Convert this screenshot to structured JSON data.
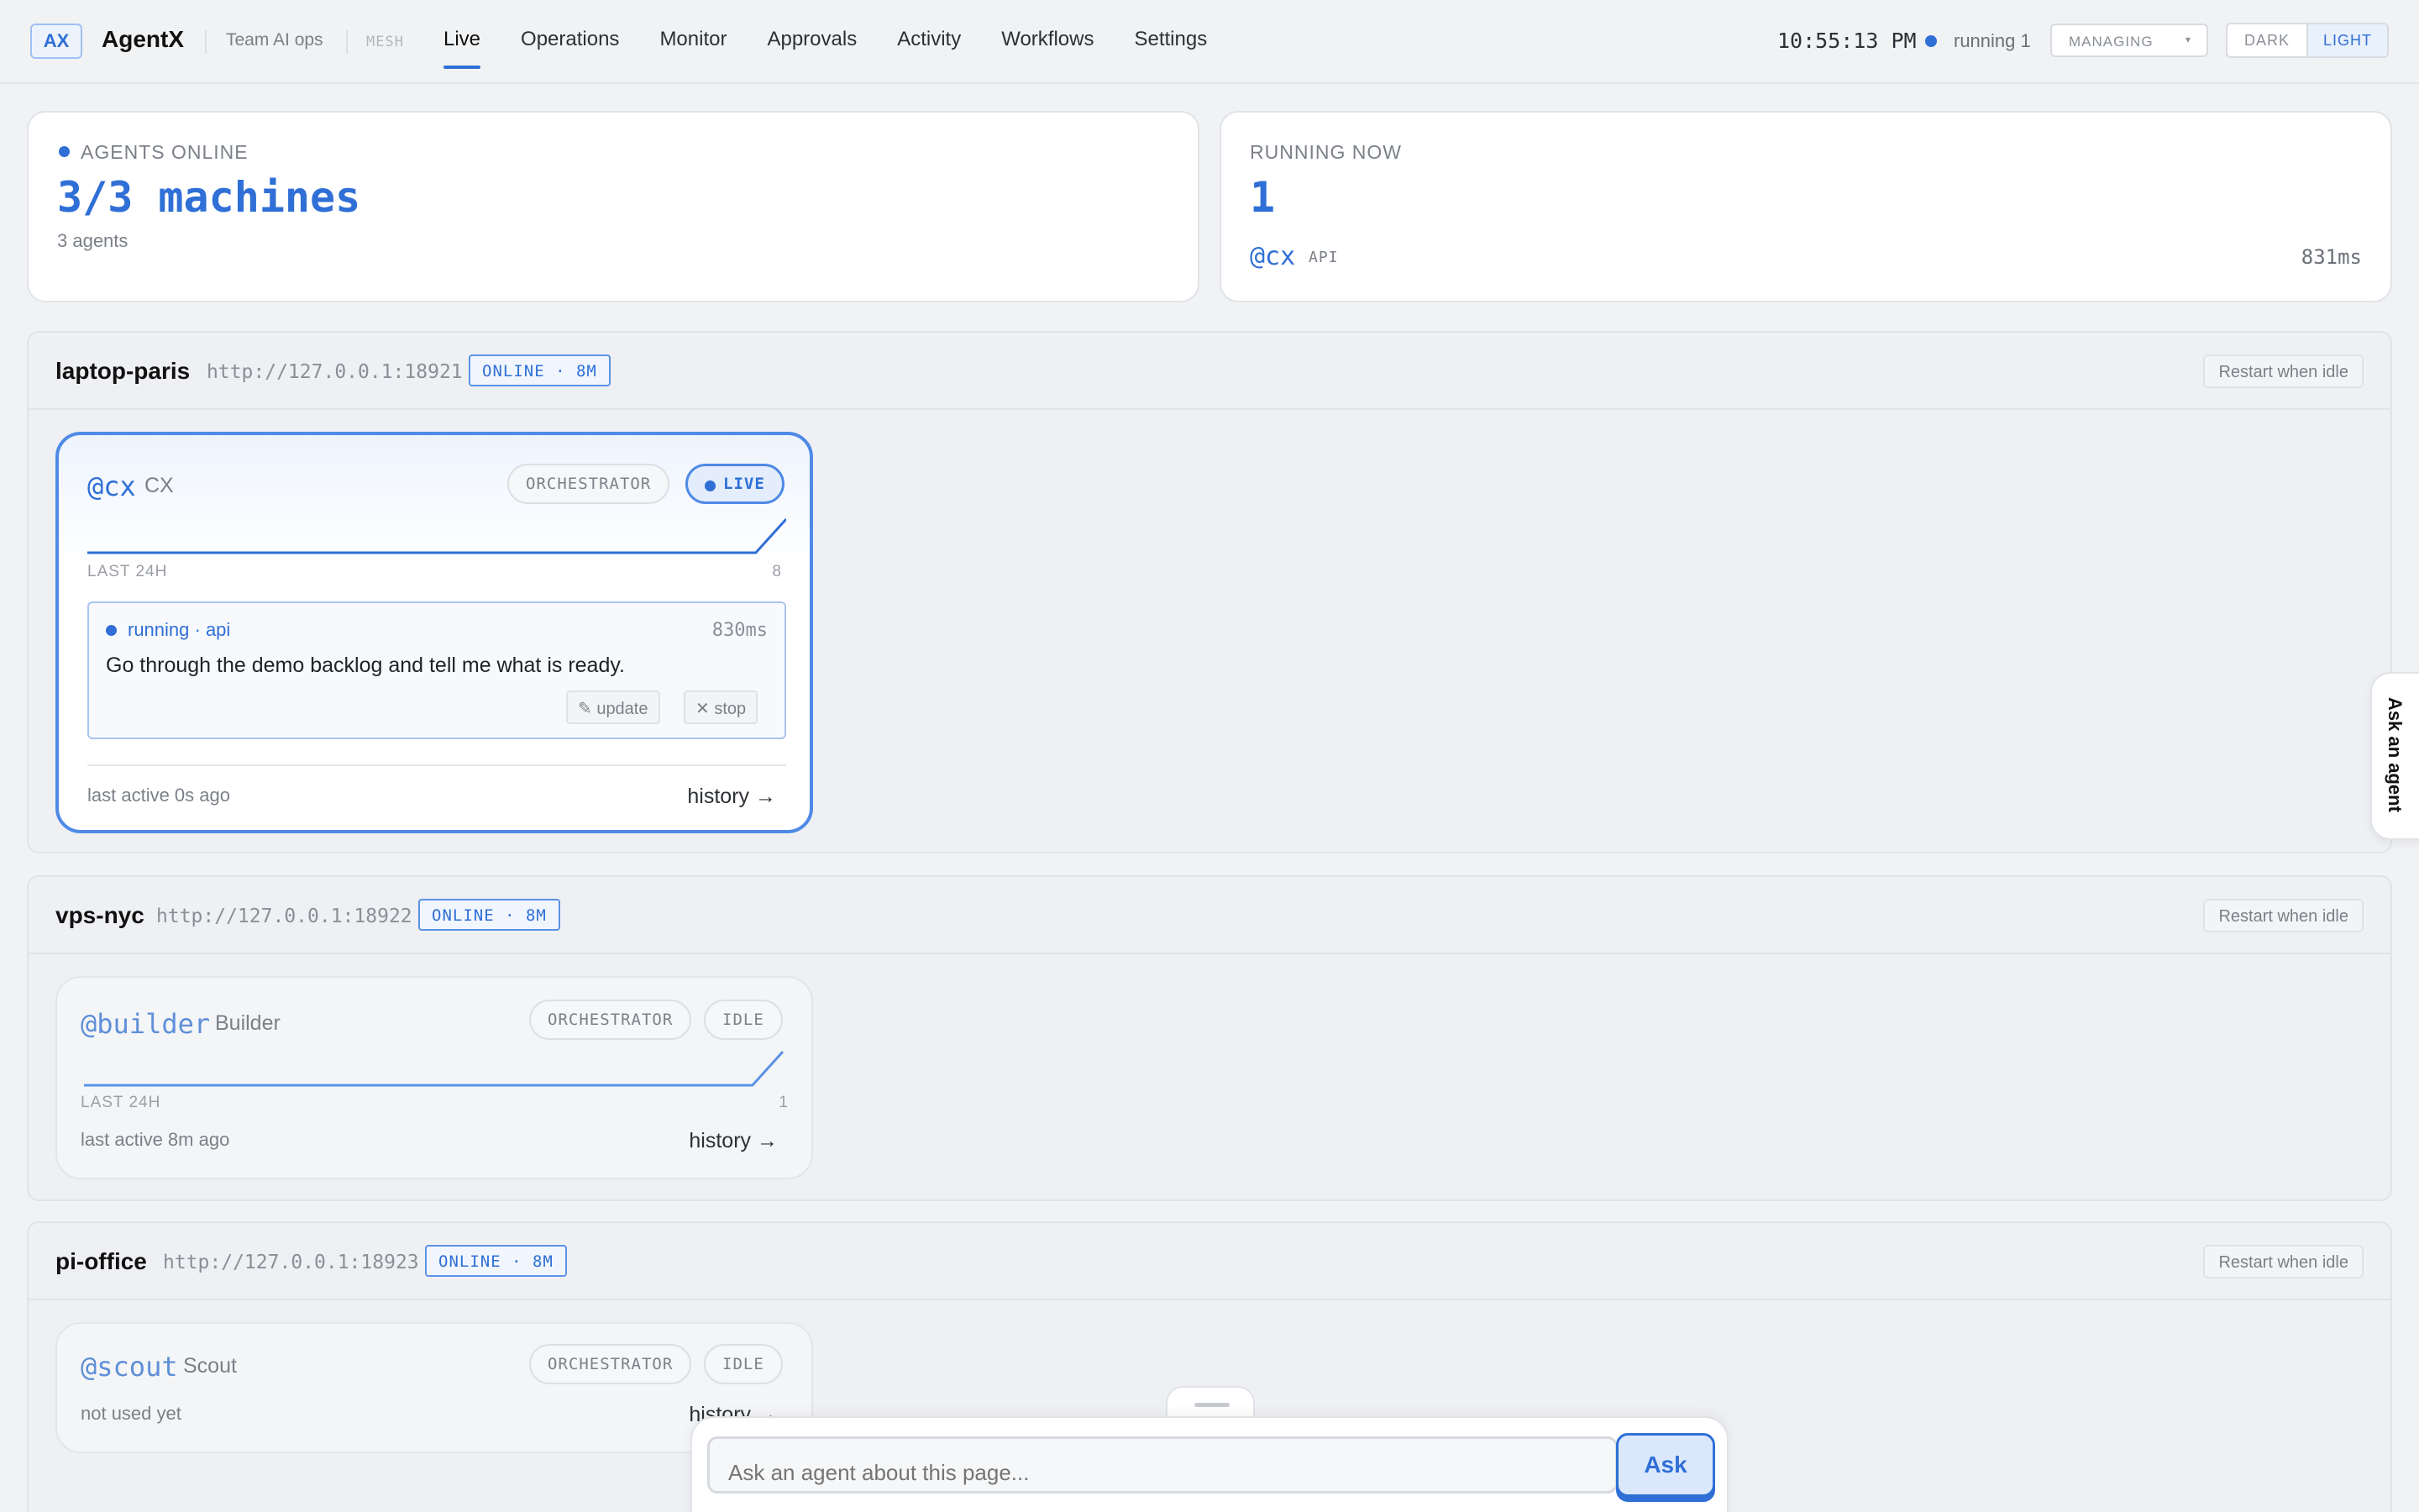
{
  "app": {
    "logo": "AX",
    "name": "AgentX",
    "team": "Team AI ops",
    "mesh_label": "MESH"
  },
  "nav": {
    "items": [
      "Live",
      "Operations",
      "Monitor",
      "Approvals",
      "Activity",
      "Workflows",
      "Settings"
    ],
    "active": "Live"
  },
  "header": {
    "clock": "10:55:13 PM",
    "running": "running 1",
    "managing": "MANAGING",
    "theme": {
      "dark": "DARK",
      "light": "LIGHT",
      "selected": "LIGHT"
    }
  },
  "stats": {
    "agents_online": {
      "label": "AGENTS ONLINE",
      "value": "3/3 machines",
      "sub": "3 agents"
    },
    "running_now": {
      "label": "RUNNING NOW",
      "value": "1",
      "handle": "@cx",
      "tag": "API",
      "ms": "831ms"
    }
  },
  "machines": [
    {
      "name": "laptop-paris",
      "url": "http://127.0.0.1:18921",
      "badge": "ONLINE · 8M",
      "restart": "Restart when idle",
      "agent": {
        "handle": "@cx",
        "name": "CX",
        "role": "ORCHESTRATOR",
        "state": "LIVE",
        "spark_label": "LAST 24H",
        "spark_max": "8",
        "spark_values": [
          0,
          0,
          0,
          0,
          0,
          0,
          0,
          0,
          0,
          0,
          0,
          0,
          0,
          0,
          0,
          0,
          0,
          0,
          0,
          0,
          0,
          0,
          0,
          8
        ],
        "task": {
          "status": "running · api",
          "ms": "830ms",
          "text": "Go through the demo backlog and tell me what is ready.",
          "update_label": "✎ update",
          "stop_label": "✕ stop"
        },
        "last_active": "last active 0s ago",
        "history": "history →"
      }
    },
    {
      "name": "vps-nyc",
      "url": "http://127.0.0.1:18922",
      "badge": "ONLINE · 8M",
      "restart": "Restart when idle",
      "agent": {
        "handle": "@builder",
        "name": "Builder",
        "role": "ORCHESTRATOR",
        "state": "IDLE",
        "spark_label": "LAST 24H",
        "spark_max": "1",
        "spark_values": [
          0,
          0,
          0,
          0,
          0,
          0,
          0,
          0,
          0,
          0,
          0,
          0,
          0,
          0,
          0,
          0,
          0,
          0,
          0,
          0,
          0,
          0,
          0,
          1
        ],
        "last_active": "last active 8m ago",
        "history": "history →"
      }
    },
    {
      "name": "pi-office",
      "url": "http://127.0.0.1:18923",
      "badge": "ONLINE · 8M",
      "restart": "Restart when idle",
      "agent": {
        "handle": "@scout",
        "name": "Scout",
        "role": "ORCHESTRATOR",
        "state": "IDLE",
        "last_active": "not used yet",
        "history": "history →"
      }
    }
  ],
  "side_tab": "Ask an agent",
  "ask": {
    "placeholder": "Ask an agent about this page...",
    "button": "Ask"
  },
  "colors": {
    "accent": "#2f6fd6",
    "background": "#f1f2f4",
    "card": "#ffffff"
  }
}
